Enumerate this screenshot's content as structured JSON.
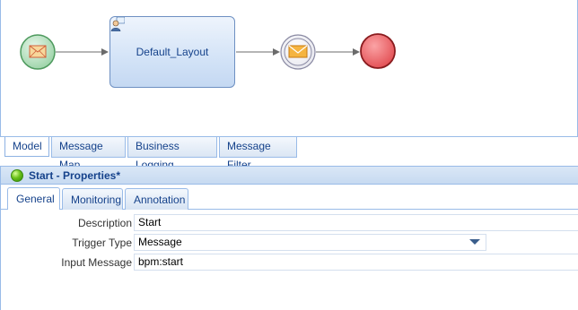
{
  "diagram": {
    "task_label": "Default_Layout"
  },
  "model_tabs": [
    {
      "label": "Model"
    },
    {
      "label": "Message Map"
    },
    {
      "label": "Business Logging"
    },
    {
      "label": "Message Filter"
    }
  ],
  "properties": {
    "title": "Start - Properties*",
    "tabs": [
      {
        "label": "General"
      },
      {
        "label": "Monitoring"
      },
      {
        "label": "Annotation"
      }
    ],
    "fields": {
      "description": {
        "label": "Description",
        "value": "Start"
      },
      "trigger_type": {
        "label": "Trigger Type",
        "value": "Message"
      },
      "input_message": {
        "label": "Input Message",
        "value": "bpm:start"
      }
    }
  },
  "colors": {
    "start_event": "#a8dcb3",
    "end_event": "#e8575b",
    "accent": "#99bbe8"
  }
}
